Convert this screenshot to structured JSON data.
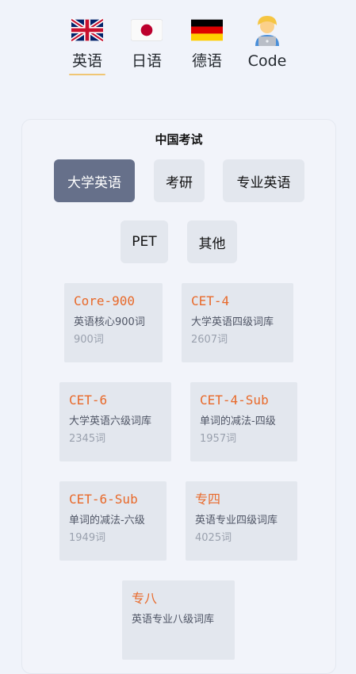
{
  "languages": [
    {
      "label": "英语",
      "flag": "uk-flag",
      "selected": true
    },
    {
      "label": "日语",
      "flag": "japan-flag",
      "selected": false
    },
    {
      "label": "德语",
      "flag": "germany-flag",
      "selected": false
    },
    {
      "label": "Code",
      "flag": "developer-emoji",
      "selected": false
    }
  ],
  "section": {
    "title": "中国考试",
    "categories": [
      {
        "label": "大学英语",
        "active": true
      },
      {
        "label": "考研",
        "active": false
      },
      {
        "label": "专业英语",
        "active": false
      },
      {
        "label": "PET",
        "active": false
      },
      {
        "label": "其他",
        "active": false
      }
    ],
    "books": [
      {
        "code": "Core-900",
        "desc": "英语核心900词",
        "count": "900词"
      },
      {
        "code": "CET-4",
        "desc": "大学英语四级词库",
        "count": "2607词"
      },
      {
        "code": "CET-6",
        "desc": "大学英语六级词库",
        "count": "2345词"
      },
      {
        "code": "CET-4-Sub",
        "desc": "单词的减法-四级",
        "count": "1957词"
      },
      {
        "code": "CET-6-Sub",
        "desc": "单词的减法-六级",
        "count": "1949词"
      },
      {
        "code": "专四",
        "desc": "英语专业四级词库",
        "count": "4025词"
      },
      {
        "code": "专八",
        "desc": "英语专业八级词库",
        "count": ""
      }
    ]
  },
  "colors": {
    "accent": "#e8692a",
    "active_category": "#66708a",
    "underline": "#f0c674"
  }
}
